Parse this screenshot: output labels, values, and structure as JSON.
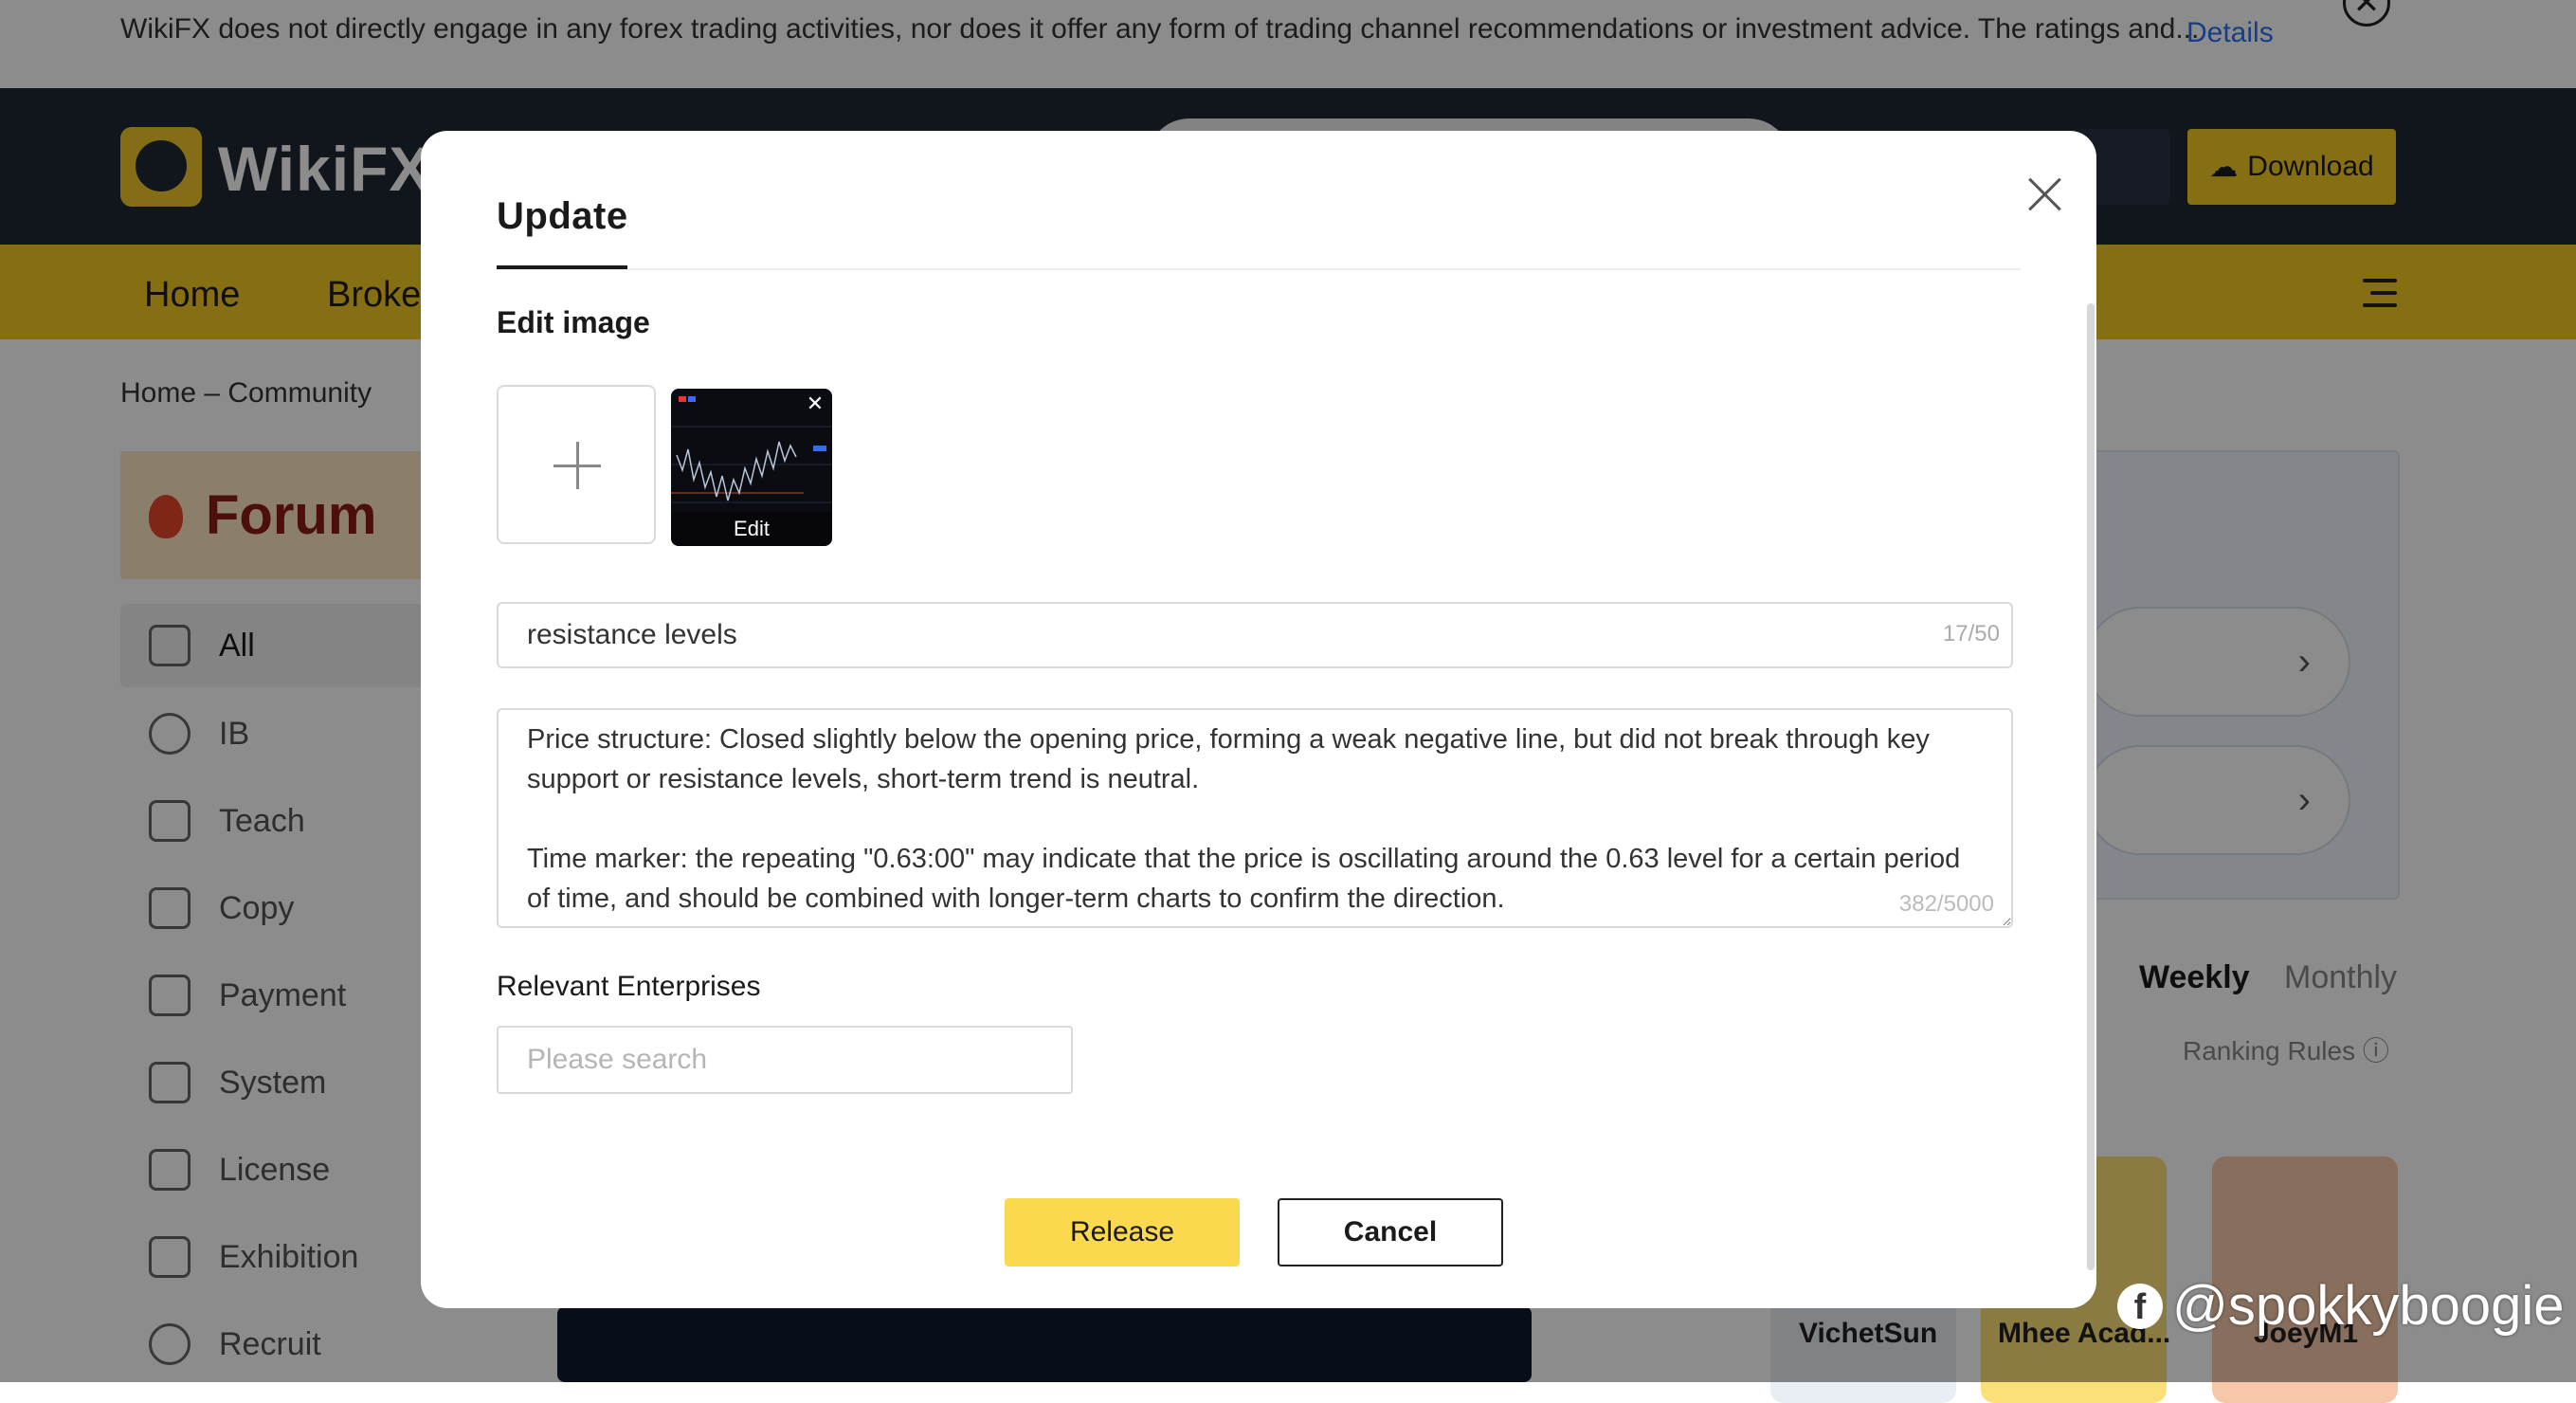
{
  "notice": {
    "text": "WikiFX does not directly engage in any forex trading activities, nor does it offer any form of trading channel recommendations or investment advice. The ratings and...",
    "details_label": "Details",
    "close_glyph": "✕"
  },
  "header": {
    "logo_text": "WikiFX",
    "download_label": "Download",
    "lang_glyph": "⌄"
  },
  "nav": {
    "items": [
      {
        "label": "Home"
      },
      {
        "label": "Broke"
      }
    ]
  },
  "breadcrumb": "Home – Community",
  "forum": {
    "title": "Forum",
    "sidebar": [
      {
        "label": "All",
        "icon": "grid-icon"
      },
      {
        "label": "IB",
        "icon": "ib-icon"
      },
      {
        "label": "Teach",
        "icon": "book-icon"
      },
      {
        "label": "Copy",
        "icon": "clipboard-icon"
      },
      {
        "label": "Payment",
        "icon": "card-icon"
      },
      {
        "label": "System",
        "icon": "wrench-icon"
      },
      {
        "label": "License",
        "icon": "license-icon"
      },
      {
        "label": "Exhibition",
        "icon": "exhibition-icon"
      },
      {
        "label": "Recruit",
        "icon": "recruit-icon"
      }
    ]
  },
  "ranking": {
    "tab_weekly": "Weekly",
    "tab_monthly": "Monthly",
    "rules_label": "Ranking Rules ⓘ",
    "users": [
      {
        "name": "VichetSun"
      },
      {
        "name": "Mhee Acad..."
      },
      {
        "name": "JoeyM1"
      }
    ]
  },
  "modal": {
    "title": "Update",
    "close_glyph": "",
    "edit_image_label": "Edit image",
    "thumb_remove_glyph": "✕",
    "thumb_edit_label": "Edit",
    "title_input_value": "resistance levels",
    "title_counter": "17/50",
    "content_value": "Price structure: Closed slightly below the opening price, forming a weak negative line, but did not break through key support or resistance levels, short-term trend is neutral.\n\nTime marker: the repeating \"0.63:00\" may indicate that the price is oscillating around the 0.63 level for a certain period of time, and should be combined with longer-term charts to confirm the direction.",
    "content_counter": "382/5000",
    "enterprises_label": "Relevant Enterprises",
    "enterprise_placeholder": "Please search",
    "release_label": "Release",
    "cancel_label": "Cancel"
  },
  "watermark": {
    "fb_glyph": "f",
    "handle": "@spokkyboogie"
  },
  "colors": {
    "brand_yellow": "#f5cb22",
    "release_yellow": "#fbd94e",
    "link_blue": "#2d6ff0",
    "header_dark": "#1f2733"
  }
}
